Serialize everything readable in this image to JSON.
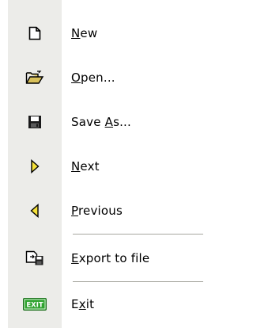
{
  "menu": {
    "items": [
      {
        "id": "new",
        "label_pre": "",
        "label_acc": "N",
        "label_post": "ew",
        "icon": "new-document-icon"
      },
      {
        "id": "open",
        "label_pre": "",
        "label_acc": "O",
        "label_post": "pen...",
        "icon": "open-folder-icon"
      },
      {
        "id": "save-as",
        "label_pre": "Save ",
        "label_acc": "A",
        "label_post": "s...",
        "icon": "floppy-disk-icon"
      },
      {
        "id": "next",
        "label_pre": "",
        "label_acc": "N",
        "label_post": "ext",
        "icon": "triangle-right-icon"
      },
      {
        "id": "previous",
        "label_pre": "",
        "label_acc": "P",
        "label_post": "revious",
        "icon": "triangle-left-icon"
      },
      {
        "id": "export",
        "label_pre": "",
        "label_acc": "E",
        "label_post": "xport to file",
        "icon": "export-file-icon"
      },
      {
        "id": "exit",
        "label_pre": "E",
        "label_acc": "x",
        "label_post": "it",
        "icon": "exit-sign-icon"
      }
    ],
    "exit_sign_text": "EXIT",
    "colors": {
      "gutter": "#ecece9",
      "separator": "#a7a7a0",
      "arrow_fill": "#f5e13a",
      "exit_green": "#2fa32f"
    }
  }
}
